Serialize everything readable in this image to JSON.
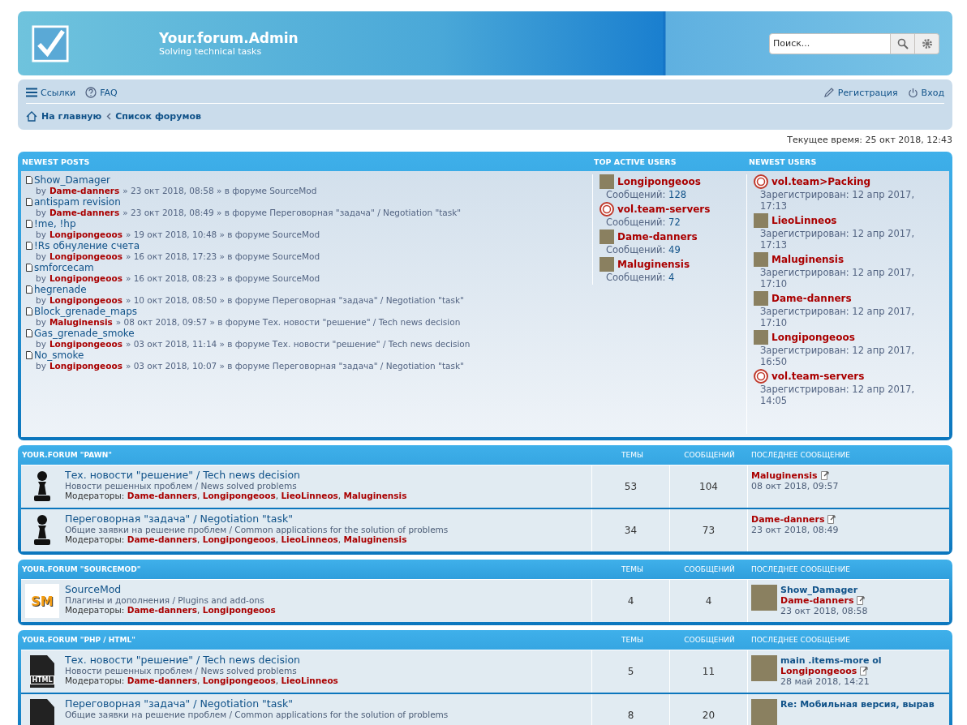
{
  "header": {
    "title": "Your.forum.Admin",
    "subtitle": "Solving technical tasks",
    "search": {
      "placeholder": "Поиск..."
    }
  },
  "navbar": {
    "links": [
      {
        "kind": "menu",
        "label": "Ссылки"
      },
      {
        "kind": "help",
        "label": "FAQ"
      }
    ],
    "user_links": [
      {
        "kind": "register",
        "label": "Регистрация"
      },
      {
        "kind": "power",
        "label": "Вход"
      }
    ],
    "breadcrumbs": [
      {
        "kind": "home",
        "label": "На главную"
      },
      {
        "kind": "chevron",
        "label": "Список форумов"
      }
    ]
  },
  "current_time": "Текущее время: 25 окт 2018, 12:43",
  "recent": {
    "posts_heading": "NEWEST POSTS",
    "active_heading": "TOP ACTIVE USERS",
    "newest_heading": "NEWEST USERS",
    "posts": [
      {
        "title": "Show_Damager",
        "by": "by",
        "author": "Dame-danners",
        "info": "» 23 окт 2018, 08:58 » в форуме SourceMod"
      },
      {
        "title": "antispam revision",
        "by": "by",
        "author": "Dame-danners",
        "info": "» 23 окт 2018, 08:49 » в форуме Переговорная \"задача\" / Negotiation \"task\""
      },
      {
        "title": "!me, !hp",
        "by": "by",
        "author": "Longipongeoos",
        "info": "» 19 окт 2018, 10:48 » в форуме SourceMod"
      },
      {
        "title": "!Rs обнуление счета",
        "by": "by",
        "author": "Longipongeoos",
        "info": "» 16 окт 2018, 17:23 » в форуме SourceMod"
      },
      {
        "title": "smforcecam",
        "by": "by",
        "author": "Longipongeoos",
        "info": "» 16 окт 2018, 08:23 » в форуме SourceMod"
      },
      {
        "title": "hegrenade",
        "by": "by",
        "author": "Longipongeoos",
        "info": "» 10 окт 2018, 08:50 » в форуме Переговорная \"задача\" / Negotiation \"task\""
      },
      {
        "title": "Block_grenade_maps",
        "by": "by",
        "author": "Maluginensis",
        "info": "» 08 окт 2018, 09:57 » в форуме Тех. новости \"решение\" / Tech news decision"
      },
      {
        "title": "Gas_grenade_smoke",
        "by": "by",
        "author": "Longipongeoos",
        "info": "» 03 окт 2018, 11:14 » в форуме Тех. новости \"решение\" / Tech news decision"
      },
      {
        "title": "No_smoke",
        "by": "by",
        "author": "Longipongeoos",
        "info": "» 03 окт 2018, 10:07 » в форуме Переговорная \"задача\" / Negotiation \"task\""
      }
    ],
    "active_users": [
      {
        "name": "Longipongeoos",
        "kind": "photo",
        "posts_label": "Сообщений:",
        "posts": "128"
      },
      {
        "name": "vol.team-servers",
        "kind": "logo",
        "posts_label": "Сообщений:",
        "posts": "72"
      },
      {
        "name": "Dame-danners",
        "kind": "photo",
        "posts_label": "Сообщений:",
        "posts": "49"
      },
      {
        "name": "Maluginensis",
        "kind": "photo",
        "posts_label": "Сообщений:",
        "posts": "4"
      }
    ],
    "newest_users": [
      {
        "name": "vol.team>Packing",
        "kind": "logo",
        "registered": "Зарегистрирован: 12 апр 2017, 17:13"
      },
      {
        "name": "LieoLinneos",
        "kind": "photo",
        "registered": "Зарегистрирован: 12 апр 2017, 17:13"
      },
      {
        "name": "Maluginensis",
        "kind": "photo",
        "registered": "Зарегистрирован: 12 апр 2017, 17:10"
      },
      {
        "name": "Dame-danners",
        "kind": "photo",
        "registered": "Зарегистрирован: 12 апр 2017, 17:10"
      },
      {
        "name": "Longipongeoos",
        "kind": "photo",
        "registered": "Зарегистрирован: 12 апр 2017, 16:50"
      },
      {
        "name": "vol.team-servers",
        "kind": "logo",
        "registered": "Зарегистрирован: 12 апр 2017, 14:05"
      }
    ]
  },
  "categories": [
    {
      "title": "YOUR.FORUM \"PAWN\"",
      "columns": [
        "ТЕМЫ",
        "СООБЩЕНИЙ",
        "ПОСЛЕДНЕЕ СООБЩЕНИЕ"
      ],
      "forums": [
        {
          "kind": "pawn",
          "name": "Тех. новости \"решение\" / Tech news decision",
          "description": "Новости решенных проблем / News solved problems",
          "moderators_label": "Модераторы:",
          "moderator_separator": ", ",
          "moderators": [
            "Dame-danners",
            "Longipongeoos",
            "LieoLinneos",
            "Maluginensis"
          ],
          "topics": "53",
          "posts": "104",
          "last_post": {
            "author": "Maluginensis",
            "date": "08 окт 2018, 09:57"
          }
        },
        {
          "kind": "pawn",
          "name": "Переговорная \"задача\" / Negotiation \"task\"",
          "description": "Общие заявки на решение проблем / Common applications for the solution of problems",
          "moderators_label": "Модераторы:",
          "moderator_separator": ", ",
          "moderators": [
            "Dame-danners",
            "Longipongeoos",
            "LieoLinneos",
            "Maluginensis"
          ],
          "topics": "34",
          "posts": "73",
          "last_post": {
            "author": "Dame-danners",
            "date": "23 окт 2018, 08:49"
          }
        }
      ]
    },
    {
      "title": "YOUR.FORUM \"SOURCEMOD\"",
      "columns": [
        "ТЕМЫ",
        "СООБЩЕНИЙ",
        "ПОСЛЕДНЕЕ СООБЩЕНИЕ"
      ],
      "forums": [
        {
          "kind": "sm",
          "logo_text": "SM",
          "name": "SourceMod",
          "description": "Плагины и дополнения / Plugins and add-ons",
          "moderators_label": "Модераторы:",
          "moderator_separator": ", ",
          "moderators": [
            "Dame-danners",
            "Longipongeoos"
          ],
          "topics": "4",
          "posts": "4",
          "last_post": {
            "kind": "photo",
            "title": "Show_Damager",
            "author": "Dame-danners",
            "date": "23 окт 2018, 08:58"
          }
        }
      ]
    },
    {
      "title": "YOUR.FORUM \"PHP / HTML\"",
      "columns": [
        "ТЕМЫ",
        "СООБЩЕНИЙ",
        "ПОСЛЕДНЕЕ СООБЩЕНИЕ"
      ],
      "forums": [
        {
          "kind": "html",
          "logo_text": "HTML",
          "name": "Тех. новости \"решение\" / Tech news decision",
          "description": "Новости решенных проблем / News solved problems",
          "moderators_label": "Модераторы:",
          "moderator_separator": ", ",
          "moderators": [
            "Dame-danners",
            "Longipongeoos",
            "LieoLinneos"
          ],
          "topics": "5",
          "posts": "11",
          "last_post": {
            "kind": "photo",
            "title": "main .items-more ol",
            "author": "Longipongeoos",
            "date": "28 май 2018, 14:21"
          }
        },
        {
          "kind": "html",
          "name": "Переговорная \"задача\" / Negotiation \"task\"",
          "description": "Общие заявки на решение проблем / Common applications for the solution of problems",
          "topics": "8",
          "posts": "20",
          "last_post": {
            "kind": "photo",
            "title": "Re: Мобильная версия, вырав"
          }
        }
      ]
    }
  ]
}
